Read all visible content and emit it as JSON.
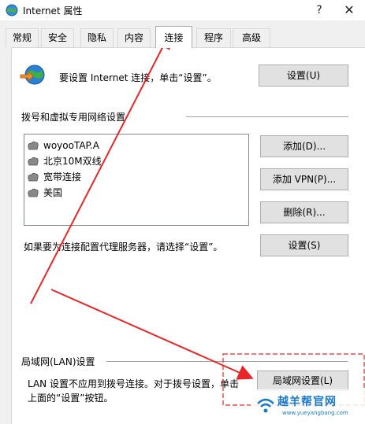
{
  "window": {
    "title": "Internet 属性",
    "help_glyph": "?",
    "close_glyph": "✕"
  },
  "tabs": [
    {
      "label": "常规"
    },
    {
      "label": "安全"
    },
    {
      "label": "隐私"
    },
    {
      "label": "内容"
    },
    {
      "label": "连接",
      "active": true
    },
    {
      "label": "程序"
    },
    {
      "label": "高级"
    }
  ],
  "setup": {
    "text": "要设置 Internet 连接，单击“设置”。",
    "button": "设置(U)"
  },
  "dialup": {
    "group_title": "拨号和虚拟专用网络设置",
    "connections": [
      "woyooTAP.A",
      "北京10M双线",
      "宽带连接",
      "美国"
    ],
    "add_button": "添加(D)...",
    "add_vpn_button": "添加 VPN(P)...",
    "remove_button": "删除(R)...",
    "proxy_text": "如果要为连接配置代理服务器，请选择“设置”。",
    "settings_button": "设置(S)"
  },
  "lan": {
    "group_title": "局域网(LAN)设置",
    "text_line1": "LAN 设置不应用到拨号连接。对于拨号设置，单击",
    "text_line2": "上面的“设置”按钮。",
    "button": "局域网设置(L)"
  },
  "watermark": {
    "text": "越羊帮官网",
    "url": "www.yueyangbang.com"
  },
  "colors": {
    "annotation": "#e8262a",
    "tab_border_active": "#adadad",
    "button_bg": "#e1e1e1"
  },
  "icons": {
    "title": "globe-connection-icon",
    "setup": "globe-arrow-icon",
    "connection": "modem-icon"
  }
}
